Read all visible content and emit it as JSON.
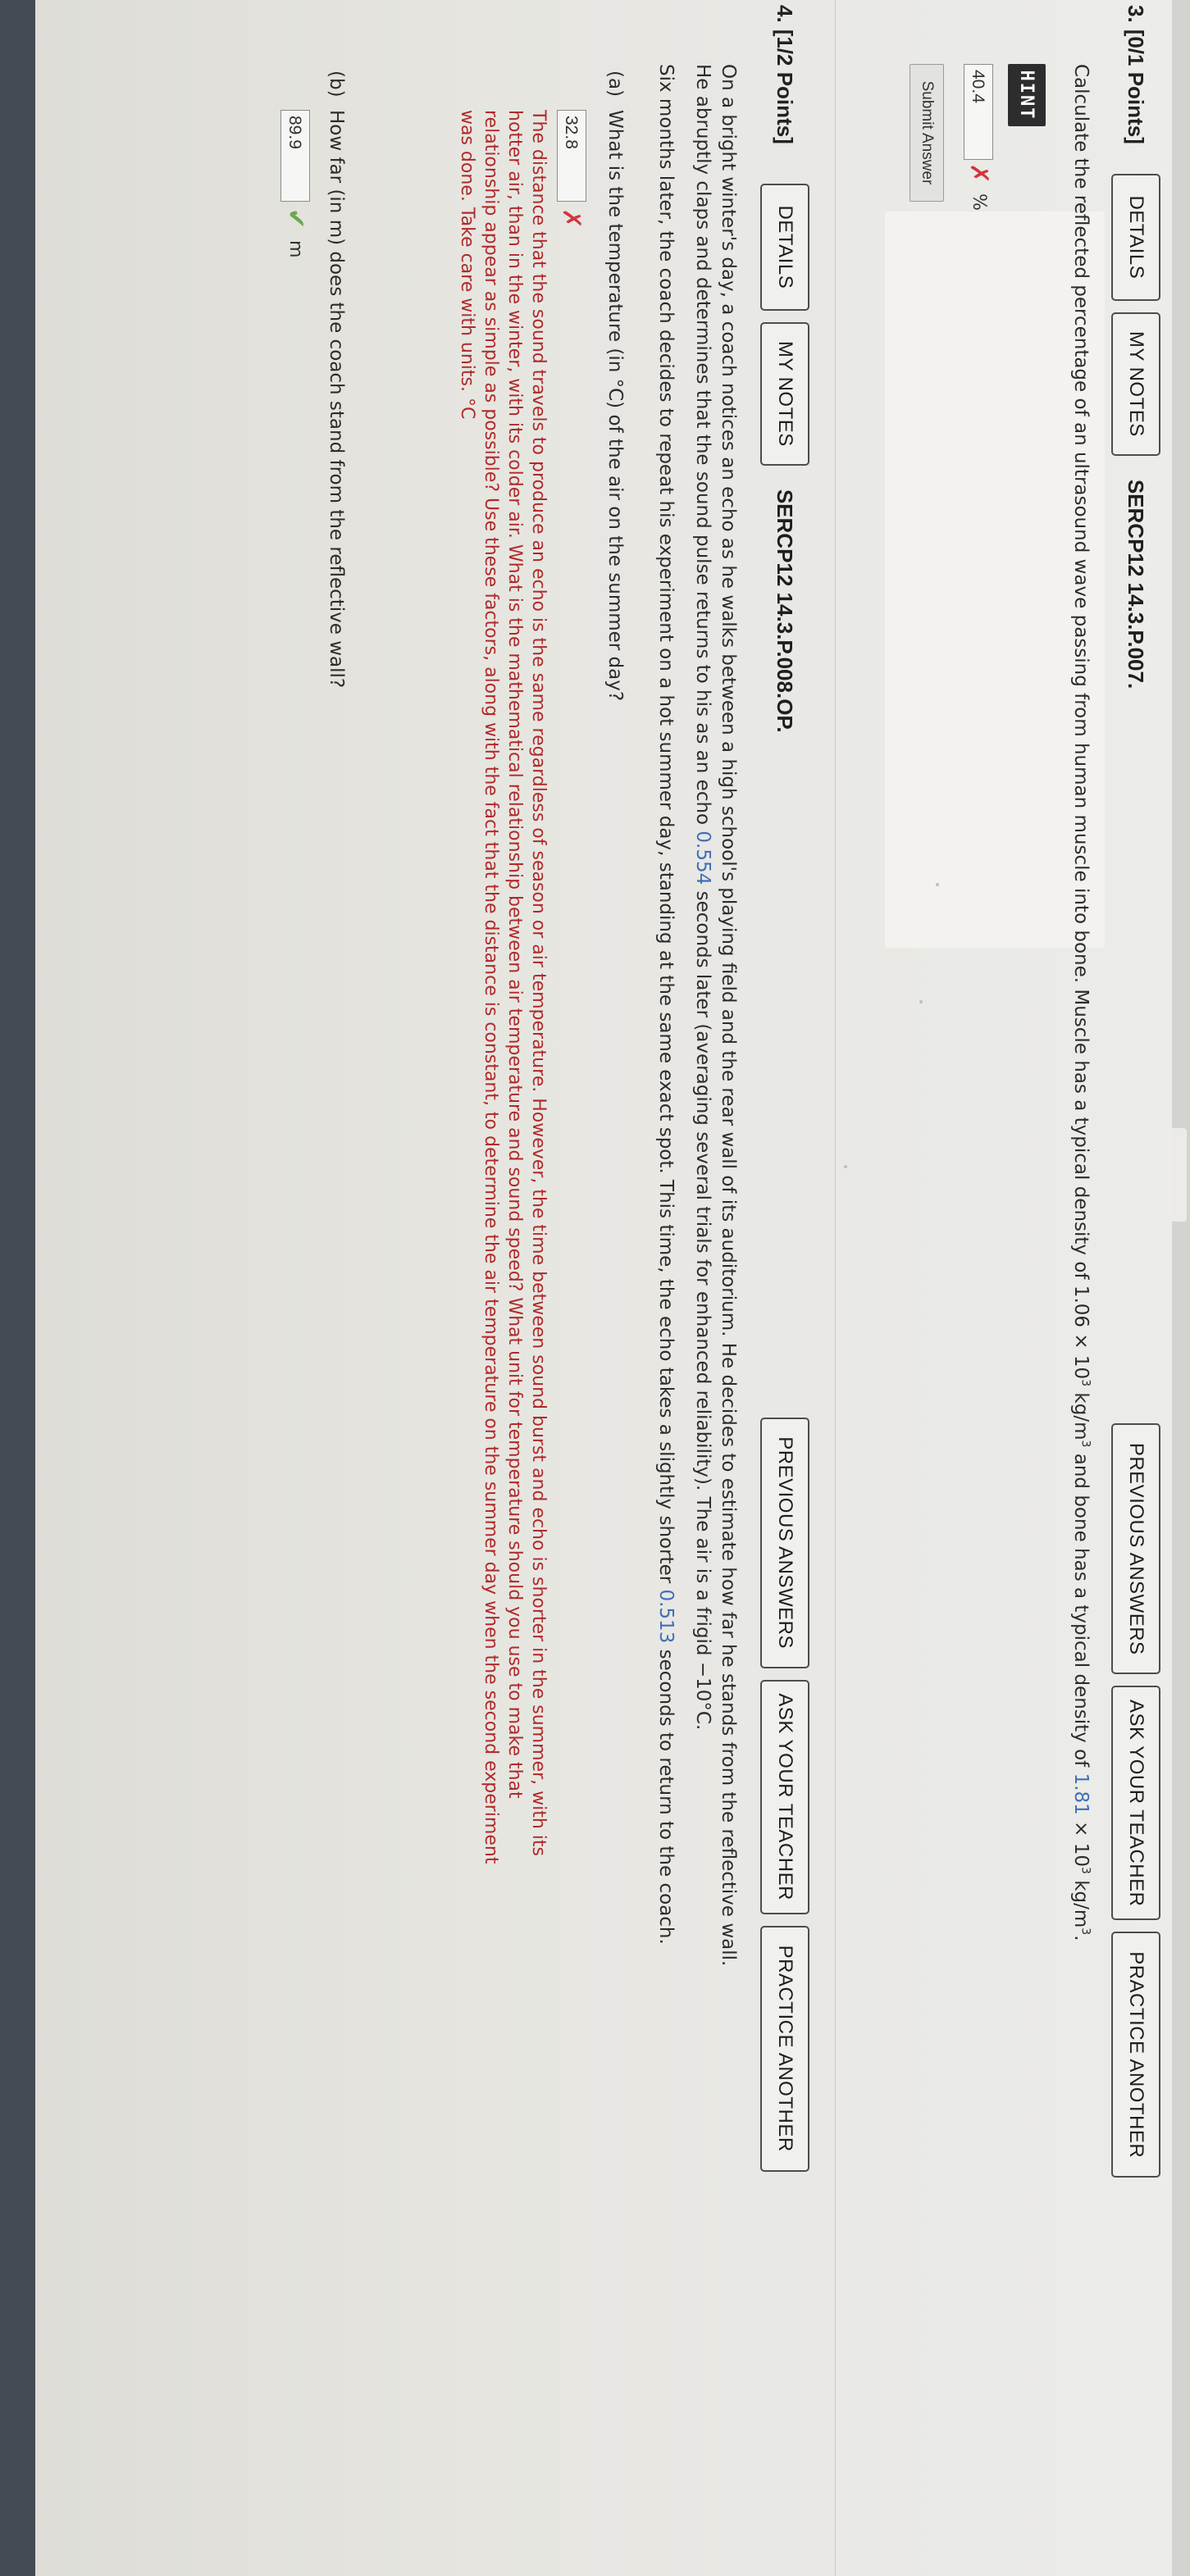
{
  "q3": {
    "number": "3.",
    "points": "[0/1 Points]",
    "details_label": "DETAILS",
    "notes_label": "MY NOTES",
    "code": "SERCP12 14.3.P.007.",
    "prev_label": "PREVIOUS ANSWERS",
    "ask_label": "ASK YOUR TEACHER",
    "practice_label": "PRACTICE ANOTHER",
    "prompt_a": "Calculate the reflected percentage of an ultrasound wave passing from human muscle into bone. Muscle has a typical density of 1.06 × 10",
    "prompt_exp1": "3",
    "prompt_b": " kg/m",
    "prompt_exp2": "3",
    "prompt_c": " and bone has a typical density of ",
    "prompt_hl": "1.81",
    "prompt_d": " × 10",
    "prompt_exp3": "3",
    "prompt_e": " kg/m",
    "prompt_exp4": "3",
    "prompt_f": ".",
    "hint_label": "HINT",
    "answer_value": "40.4",
    "answer_status": "incorrect",
    "answer_unit": "%",
    "submit_label": "Submit Answer"
  },
  "q4": {
    "number": "4.",
    "points": "[1/2 Points]",
    "details_label": "DETAILS",
    "notes_label": "MY NOTES",
    "code": "SERCP12 14.3.P.008.OP.",
    "prev_label": "PREVIOUS ANSWERS",
    "ask_label": "ASK YOUR TEACHER",
    "practice_label": "PRACTICE ANOTHER",
    "intro_line1": "On a bright winter's day, a coach notices an echo as he walks between a high school's playing field and the rear wall of its auditorium. He decides to estimate how far he stands from the reflective wall.",
    "intro_line2a": "He abruptly claps and determines that the sound pulse returns to his as an echo ",
    "intro_line2_hl": "0.554",
    "intro_line2b": " seconds later (averaging several trials for enhanced reliability). The air is a frigid −10°C.",
    "intro_line3a": "Six months later, the coach decides to repeat his experiment on a hot summer day, standing at the same exact spot. This time, the echo takes a slightly shorter ",
    "intro_line3_hl": "0.513",
    "intro_line3b": " seconds to return to the coach.",
    "part_a_label": "(a)",
    "part_a_text": "What is the temperature (in °C) of the air on the summer day?",
    "part_a_value": "32.8",
    "part_a_status": "incorrect",
    "feedback_line1": "The distance that the sound travels to produce an echo is the same regardless of season or air temperature. However, the time between sound burst and echo is shorter in the summer, with its",
    "feedback_line2": "hotter air, than in the winter, with its colder air. What is the mathematical relationship between air temperature and sound speed? What unit for temperature should you use to make that",
    "feedback_line3": "relationship appear as simple as possible? Use these factors, along with the fact that the distance is constant, to determine the air temperature on the summer day when the second experiment",
    "feedback_line4": "was done. Take care with units. °C",
    "part_b_label": "(b)",
    "part_b_text": "How far (in m) does the coach stand from the reflective wall?",
    "part_b_value": "89.9",
    "part_b_status": "correct",
    "part_b_unit": "m"
  },
  "icons": {
    "incorrect": "x-mark-icon",
    "correct": "check-icon"
  },
  "colors": {
    "highlight_value": "#3e6fb8",
    "incorrect": "#d3343c",
    "correct": "#6aa84f",
    "feedback_text": "#b02a2a"
  }
}
